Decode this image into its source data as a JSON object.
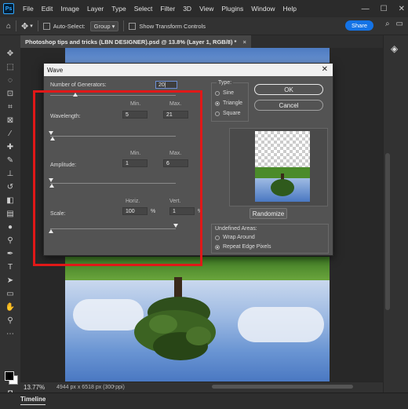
{
  "app": {
    "logo_text": "Ps"
  },
  "menu": [
    "File",
    "Edit",
    "Image",
    "Layer",
    "Type",
    "Select",
    "Filter",
    "3D",
    "View",
    "Plugins",
    "Window",
    "Help"
  ],
  "window_controls": {
    "minimize": "—",
    "maximize": "☐",
    "close": "✕"
  },
  "options_bar": {
    "auto_select_label": "Auto-Select:",
    "auto_select_value": "Group",
    "transform_label": "Show Transform Controls",
    "share_label": "Share"
  },
  "document": {
    "tab_title": "Photoshop tips and tricks (LBN DESIGNER).psd @ 13.8% (Layer 1, RGB/8) *",
    "tab_close": "×"
  },
  "status": {
    "zoom": "13.77%",
    "info": "4944 px x 6518 px (300 ppi)",
    "expand": "›"
  },
  "timeline": {
    "label": "Timeline"
  },
  "dialog": {
    "title": "Wave",
    "close": "✕",
    "generators_label": "Number of Generators:",
    "generators_value": "20|",
    "min_header": "Min.",
    "max_header": "Max.",
    "wavelength_label": "Wavelength:",
    "wavelength_min": "5",
    "wavelength_max": "21",
    "amplitude_label": "Amplitude:",
    "amplitude_min": "1",
    "amplitude_max": "6",
    "horiz_header": "Horiz.",
    "vert_header": "Vert.",
    "scale_label": "Scale:",
    "scale_horiz": "100",
    "scale_vert": "1",
    "percent": "%",
    "type_label": "Type:",
    "type_options": [
      "Sine",
      "Triangle",
      "Square"
    ],
    "type_selected": "Triangle",
    "ok_label": "OK",
    "cancel_label": "Cancel",
    "randomize_label": "Randomize",
    "undefined_label": "Undefined Areas:",
    "undefined_options": [
      "Wrap Around",
      "Repeat Edge Pixels"
    ],
    "undefined_selected": "Repeat Edge Pixels"
  },
  "colors": {
    "highlight_box": "#e01818",
    "share_blue": "#1473e6"
  }
}
